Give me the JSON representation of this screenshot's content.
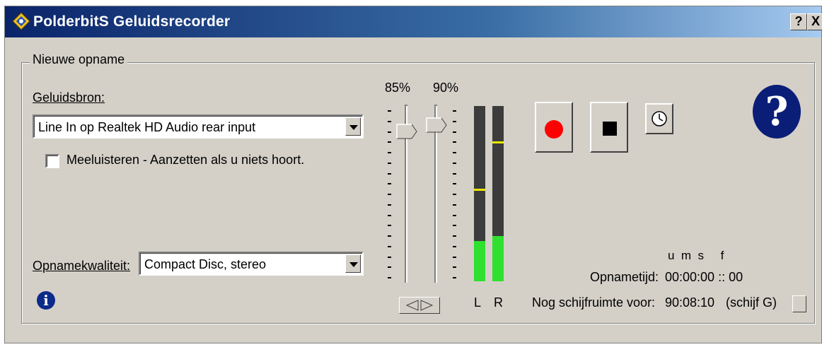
{
  "window": {
    "title": "PolderbitS Geluidsrecorder",
    "help_button": "?",
    "close_button": "X"
  },
  "group": {
    "label": "Nieuwe opname"
  },
  "source": {
    "label": "Geluidsbron:",
    "value": "Line In op Realtek HD Audio rear input"
  },
  "monitor": {
    "label": "Meeluisteren - Aanzetten als u niets hoort.",
    "checked": false
  },
  "quality": {
    "label": "Opnamekwaliteit:",
    "value": "Compact Disc, stereo"
  },
  "volume": {
    "left_percent": "85%",
    "right_percent": "90%",
    "left_level": 0.85,
    "right_level": 0.9
  },
  "meters": {
    "left_label": "L",
    "right_label": "R",
    "left_level": 0.23,
    "right_level": 0.26,
    "left_peak": 0.53,
    "right_peak": 0.8
  },
  "time": {
    "units_header": "u  m  s     f",
    "rec_label": "Opnametijd:",
    "rec_value": "00:00:00 :: 00",
    "space_label": "Nog schijfruimte voor:",
    "space_value": "90:08:10",
    "drive": "(schijf G)"
  },
  "icons": {
    "app": "app-icon",
    "record": "record-icon",
    "stop": "stop-icon",
    "timer": "timer-icon",
    "help": "help-icon",
    "info": "info-icon"
  },
  "colors": {
    "record": "#ff0000",
    "meter_fill": "#2fe02f",
    "meter_peak": "#e8e800",
    "help": "#0a1e78"
  }
}
